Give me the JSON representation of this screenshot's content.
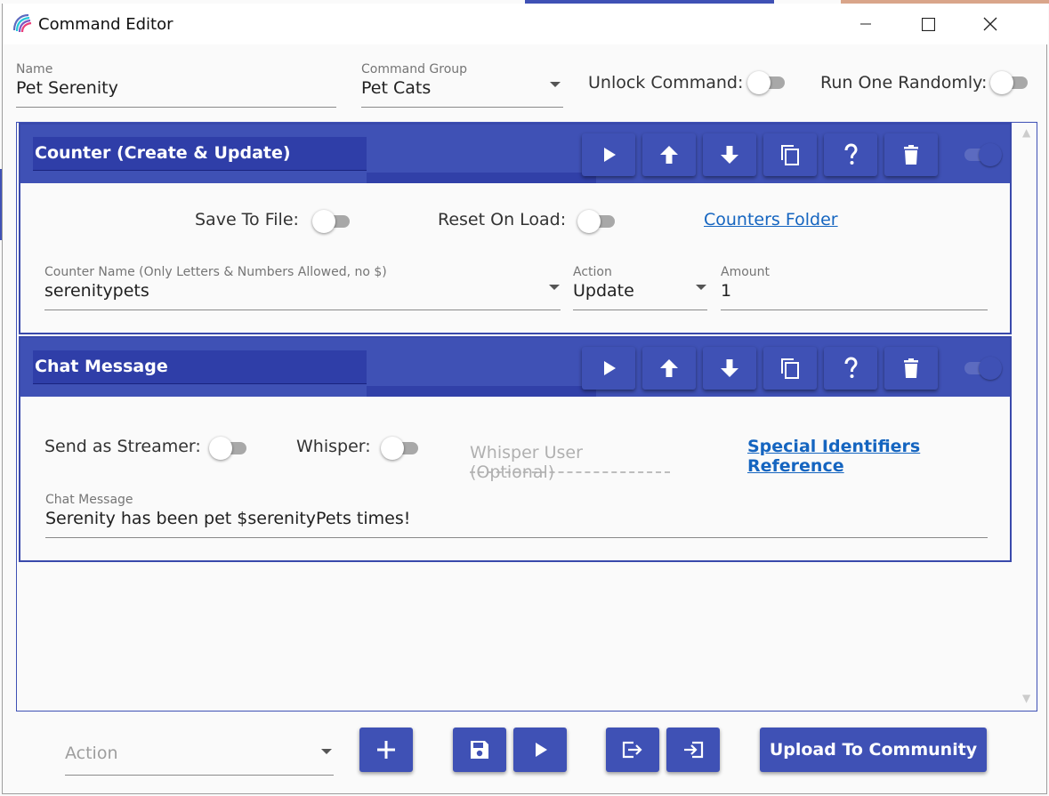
{
  "window": {
    "title": "Command Editor"
  },
  "command": {
    "name_label": "Name",
    "name_value": "Pet Serenity",
    "group_label": "Command Group",
    "group_value": "Pet Cats",
    "unlock_label": "Unlock Command:",
    "unlock_on": false,
    "random_label": "Run One Randomly:",
    "random_on": false
  },
  "actions": [
    {
      "title": "Counter (Create & Update)",
      "enabled": true,
      "save_to_file_label": "Save To File:",
      "save_to_file_on": false,
      "reset_on_load_label": "Reset On Load:",
      "reset_on_load_on": false,
      "folder_link": "Counters Folder",
      "counter_name_label": "Counter Name (Only Letters & Numbers Allowed, no $)",
      "counter_name_value": "serenitypets",
      "action_label": "Action",
      "action_value": "Update",
      "amount_label": "Amount",
      "amount_value": "1"
    },
    {
      "title": "Chat Message",
      "enabled": true,
      "send_as_streamer_label": "Send as Streamer:",
      "send_as_streamer_on": false,
      "whisper_label": "Whisper:",
      "whisper_on": false,
      "whisper_user_placeholder": "Whisper User (Optional)",
      "reference_link": "Special Identifiers Reference",
      "message_label": "Chat Message",
      "message_value": "Serenity has been pet $serenityPets times!"
    }
  ],
  "footer": {
    "action_placeholder": "Action",
    "upload_label": "Upload To Community"
  },
  "colors": {
    "accent": "#3f51b5",
    "link": "#1565c0"
  }
}
